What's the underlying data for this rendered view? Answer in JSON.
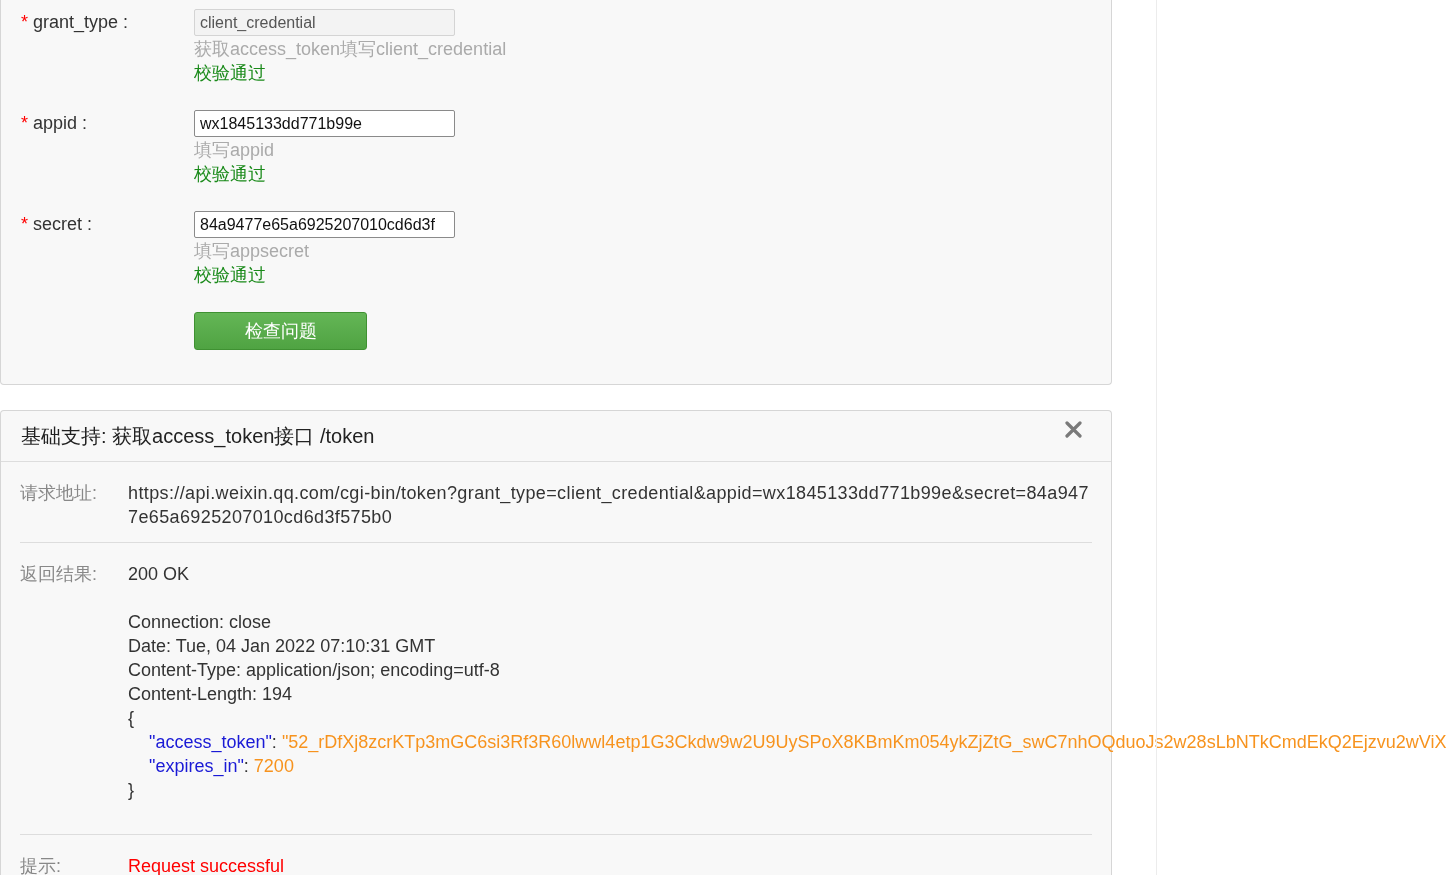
{
  "form": {
    "fields": [
      {
        "required_mark": "*",
        "label": "grant_type :",
        "value": "client_credential",
        "disabled": true,
        "hint": "获取access_token填写client_credential",
        "validation": "校验通过",
        "valid": true
      },
      {
        "required_mark": "*",
        "label": "appid :",
        "value": "wx1845133dd771b99e",
        "disabled": false,
        "hint": "填写appid",
        "validation": "校验通过",
        "valid": true
      },
      {
        "required_mark": "*",
        "label": "secret :",
        "value": "84a9477e65a6925207010cd6d3f",
        "disabled": false,
        "hint": "填写appsecret",
        "validation": "校验通过",
        "valid": true
      }
    ],
    "submit_button": "检查问题"
  },
  "result_panel": {
    "title": "基础支持: 获取access_token接口 /token",
    "rows": [
      {
        "kind": "text",
        "label": "请求地址:",
        "value": "https://api.weixin.qq.com/cgi-bin/token?grant_type=client_credential&appid=wx1845133dd771b99e&secret=84a9477e65a6925207010cd6d3f575b0"
      },
      {
        "kind": "response",
        "label": "返回结果:",
        "status": "200 OK",
        "headers": [
          "Connection: close",
          "Date: Tue, 04 Jan 2022 07:10:31 GMT",
          "Content-Type: application/json; encoding=utf-8",
          "Content-Length: 194"
        ],
        "body_open": "{",
        "body": [
          {
            "key": "\"access_token\"",
            "separator": ":",
            "value": "\"52_rDfXj8zcrKTp3mGC6si3Rf3R60lwwl4etp1G3Ckdw9w2U9UySPoX8KBmKm054ykZjZtG_swC7nhOQduoJs2w28sLbNTkCmdEkQ2Ejzvu2wViX"
          },
          {
            "key": "\"expires_in\"",
            "separator": ":",
            "value": "7200"
          }
        ],
        "body_close": "}"
      },
      {
        "kind": "message",
        "label": "提示:",
        "value": "Request successful"
      }
    ]
  }
}
